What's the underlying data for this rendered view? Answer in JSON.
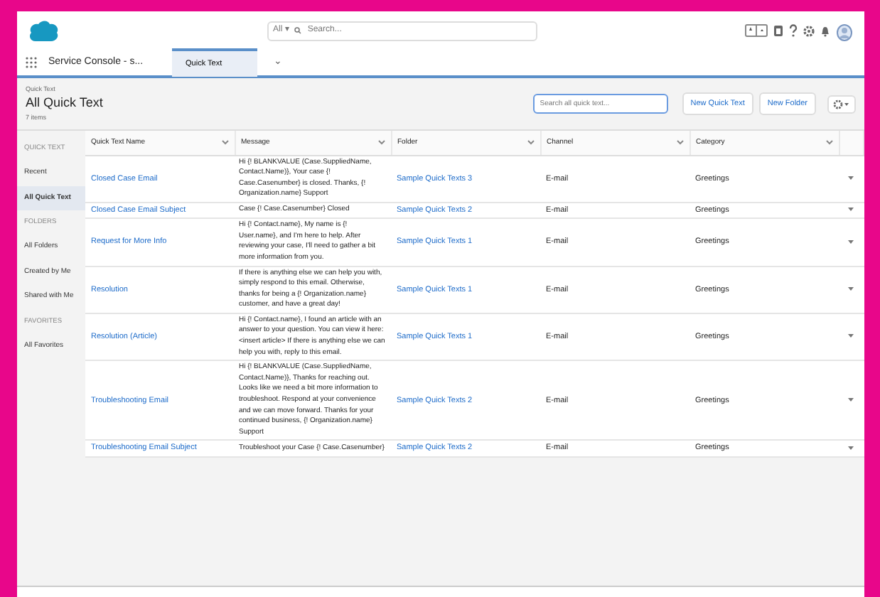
{
  "global_header": {
    "scope": "All ▾",
    "search_placeholder": "Search..."
  },
  "nav": {
    "app_name": "Service Console - s...",
    "tabs": [
      {
        "label": "Quick Text",
        "selected": true
      }
    ],
    "tab_menu": "⌄"
  },
  "page_header": {
    "object": "Quick Text",
    "title": "All Quick Text",
    "count": "7 items",
    "search_placeholder": "Search all quick text...",
    "buttons": [
      "New Quick Text",
      "New Folder"
    ]
  },
  "sidebar": {
    "sections": [
      {
        "heading": "QUICK TEXT",
        "items": [
          {
            "label": "Recent",
            "selected": false
          },
          {
            "label": "All Quick Text",
            "selected": true
          }
        ]
      },
      {
        "heading": "FOLDERS",
        "items": [
          {
            "label": "All Folders",
            "selected": false
          },
          {
            "label": "Created by Me",
            "selected": false
          },
          {
            "label": "Shared with Me",
            "selected": false
          }
        ]
      },
      {
        "heading": "FAVORITES",
        "items": [
          {
            "label": "All Favorites",
            "selected": false
          }
        ]
      }
    ]
  },
  "table": {
    "columns": [
      "Quick Text Name",
      "Message",
      "Folder",
      "Channel",
      "Category"
    ],
    "rows": [
      {
        "name": "Closed Case Email",
        "message": "Hi {! BLANKVALUE (Case.SuppliedName, Contact.Name)}, Your case {! Case.Casenumber} is closed. Thanks, {! Organization.name} Support",
        "folder": "Sample Quick Texts 3",
        "channel": "E-mail",
        "category": "Greetings"
      },
      {
        "name": "Closed Case Email Subject",
        "message": "Case {! Case.Casenumber} Closed",
        "folder": "Sample Quick Texts 2",
        "channel": "E-mail",
        "category": "Greetings"
      },
      {
        "name": "Request for More Info",
        "message": "Hi {! Contact.name}, My name is {! User.name}, and I'm here to help. After reviewing your case, I'll need to gather a bit more information from you.",
        "folder": "Sample Quick Texts 1",
        "channel": "E-mail",
        "category": "Greetings"
      },
      {
        "name": "Resolution",
        "message": "If there is anything else we can help you with, simply respond to this email. Otherwise, thanks for being a {! Organization.name} customer, and have a great day!",
        "folder": "Sample Quick Texts 1",
        "channel": "E-mail",
        "category": "Greetings"
      },
      {
        "name": "Resolution (Article)",
        "message": "Hi {! Contact.name}, I found an article with an answer to your question. You can view it here: <insert article> If there is anything else we can help you with, reply to this email.",
        "folder": "Sample Quick Texts 1",
        "channel": "E-mail",
        "category": "Greetings"
      },
      {
        "name": "Troubleshooting Email",
        "message": "Hi {! BLANKVALUE (Case.SuppliedName, Contact.Name)}, Thanks for reaching out. Looks like we need a bit more information to troubleshoot. Respond at your convenience and we can move forward. Thanks for your continued business, {! Organization.name} Support",
        "folder": "Sample Quick Texts 2",
        "channel": "E-mail",
        "category": "Greetings"
      },
      {
        "name": "Troubleshooting Email Subject",
        "message": "Troubleshoot your Case {! Case.Casenumber}",
        "folder": "Sample Quick Texts 2",
        "channel": "E-mail",
        "category": "Greetings"
      }
    ]
  }
}
